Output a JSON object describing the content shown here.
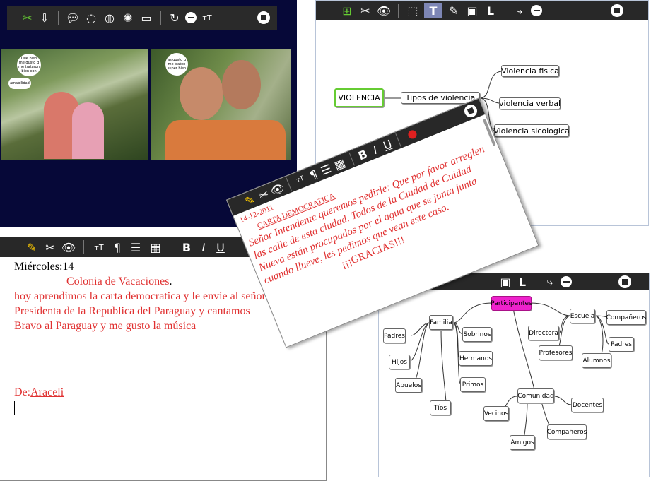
{
  "photo_window": {
    "bubble_1": "Que bien me gusto q me trataron bien con",
    "bubble_2": "amabilidad",
    "bubble_3": "as gusto q me traten super bien"
  },
  "mindmap_violencia": {
    "central": "VIOLENCIA",
    "mid": "Tipos de violencia",
    "leaves": [
      "Violencia fisica",
      "violencia verbal",
      "Violencia sicologica"
    ],
    "accent": "#66cc33"
  },
  "letter": {
    "date": "14-12-2011",
    "title": "CARTA DEMOCRATICA",
    "body": "Señor Intendente queremos pedirle: Que por favor arreglen las calle de esta ciudad. Todos de la Ciudad de Cuidad Nueva están procupados por el agua que se junta junta cuando llueve, les pedimos que vean este caso.",
    "thanks": "¡¡¡GRACIAS!!!",
    "text_color": "#e03030",
    "record_color": "#e02020"
  },
  "diary": {
    "line1": "Miércoles:14",
    "title": "Colonia de Vacaciones",
    "title_end": ".",
    "body": "hoy aprendimos la carta democratica y le envie al señor Presidenta de la Republica del Paraguay y cantamos Bravo al Paraguay y me gusto la música",
    "signature_prefix": "De:",
    "signature_name": "Araceli",
    "toolbar_text_label": "T",
    "text_color": "#e03030"
  },
  "mindmap_participantes": {
    "central": "Participantes",
    "central_color": "#ee22cc",
    "familia": "Familia",
    "escuela": "Escuela",
    "comunidad": "Comunidad",
    "nodes": [
      "Padres",
      "Hijos",
      "Abuelos",
      "Tíos",
      "Sobrinos",
      "Hermanos",
      "Primos",
      "Directora",
      "Profesores",
      "Alumnos",
      "Compañeros",
      "Padres",
      "Vecinos",
      "Amigos",
      "Compañeros",
      "Docentes"
    ]
  }
}
